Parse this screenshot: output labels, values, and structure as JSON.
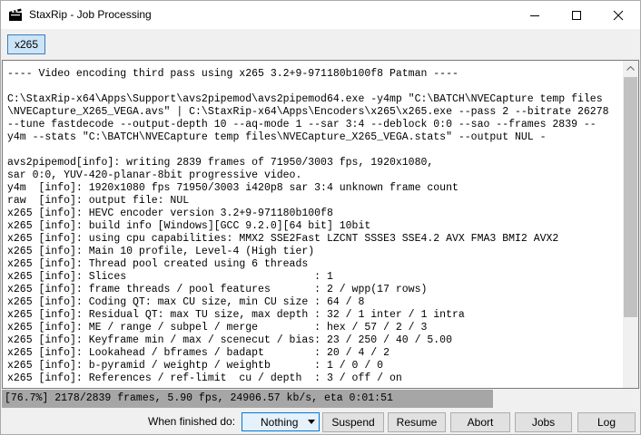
{
  "window": {
    "title": "StaxRip - Job Processing",
    "icon": "clapperboard-icon",
    "controls": [
      "minimize-icon",
      "maximize-icon",
      "close-icon"
    ]
  },
  "tabs": [
    {
      "label": "x265",
      "selected": true
    }
  ],
  "log": {
    "lines": [
      "---- Video encoding third pass using x265 3.2+9-971180b100f8 Patman ----",
      "",
      "C:\\StaxRip-x64\\Apps\\Support\\avs2pipemod\\avs2pipemod64.exe -y4mp \"C:\\BATCH\\NVECapture temp files",
      "\\NVECapture_X265_VEGA.avs\" | C:\\StaxRip-x64\\Apps\\Encoders\\x265\\x265.exe --pass 2 --bitrate 26278",
      "--tune fastdecode --output-depth 10 --aq-mode 1 --sar 3:4 --deblock 0:0 --sao --frames 2839 --",
      "y4m --stats \"C:\\BATCH\\NVECapture temp files\\NVECapture_X265_VEGA.stats\" --output NUL -",
      "",
      "avs2pipemod[info]: writing 2839 frames of 71950/3003 fps, 1920x1080,",
      "sar 0:0, YUV-420-planar-8bit progressive video.",
      "y4m  [info]: 1920x1080 fps 71950/3003 i420p8 sar 3:4 unknown frame count",
      "raw  [info]: output file: NUL",
      "x265 [info]: HEVC encoder version 3.2+9-971180b100f8",
      "x265 [info]: build info [Windows][GCC 9.2.0][64 bit] 10bit",
      "x265 [info]: using cpu capabilities: MMX2 SSE2Fast LZCNT SSSE3 SSE4.2 AVX FMA3 BMI2 AVX2",
      "x265 [info]: Main 10 profile, Level-4 (High tier)",
      "x265 [info]: Thread pool created using 6 threads",
      "x265 [info]: Slices                              : 1",
      "x265 [info]: frame threads / pool features       : 2 / wpp(17 rows)",
      "x265 [info]: Coding QT: max CU size, min CU size : 64 / 8",
      "x265 [info]: Residual QT: max TU size, max depth : 32 / 1 inter / 1 intra",
      "x265 [info]: ME / range / subpel / merge         : hex / 57 / 2 / 3",
      "x265 [info]: Keyframe min / max / scenecut / bias: 23 / 250 / 40 / 5.00",
      "x265 [info]: Lookahead / bframes / badapt        : 20 / 4 / 2",
      "x265 [info]: b-pyramid / weightp / weightb       : 1 / 0 / 0",
      "x265 [info]: References / ref-limit  cu / depth  : 3 / off / on"
    ]
  },
  "status": {
    "text": "[76.7%] 2178/2839 frames, 5.90 fps, 24906.57 kb/s, eta 0:01:51",
    "progress_percent": 76.7
  },
  "footer": {
    "finished_label": "When finished do:",
    "finished_value": "Nothing",
    "buttons": {
      "suspend": "Suspend",
      "resume": "Resume",
      "abort": "Abort",
      "jobs": "Jobs",
      "log": "Log"
    }
  }
}
